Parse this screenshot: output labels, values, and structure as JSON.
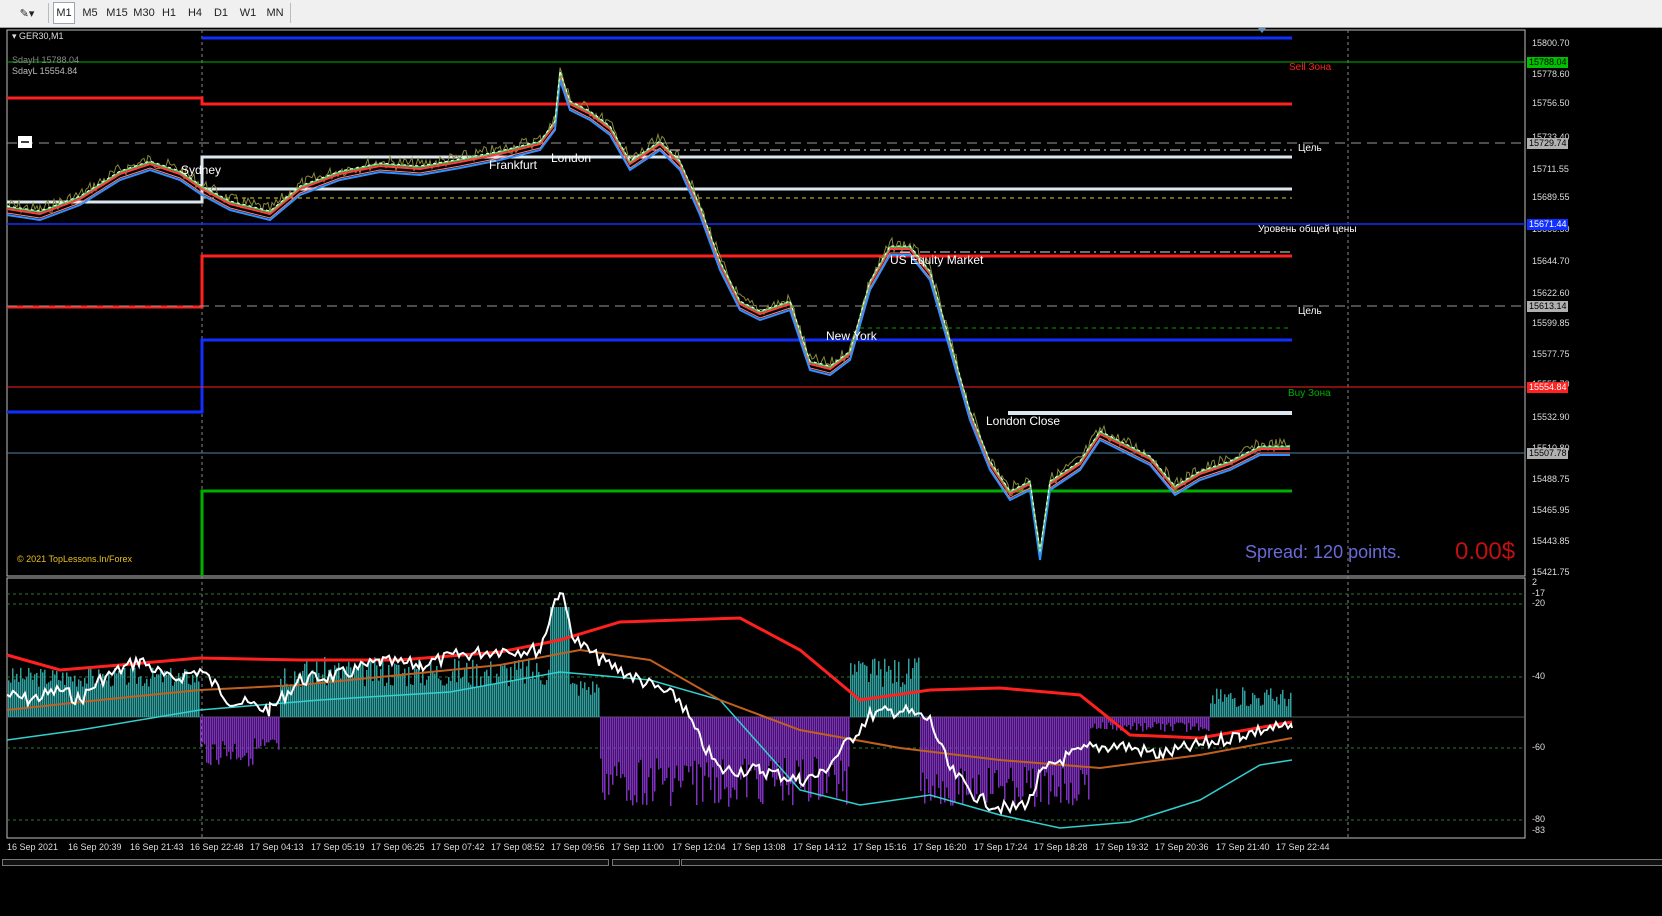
{
  "toolbar": {
    "timeframes": [
      "M1",
      "M5",
      "M15",
      "M30",
      "H1",
      "H4",
      "D1",
      "W1",
      "MN"
    ],
    "active": "M1"
  },
  "chart": {
    "symbol": "GER30,M1",
    "sdayh": "SdayH 15788.04",
    "sdayl": "SdayL 15554.84",
    "copyright": "© 2021 TopLessons.In/Forex",
    "spread": "Spread: 120 points.",
    "profit": "0.00$",
    "sessions": {
      "sydney": "Sydney",
      "frankfurt": "Frankfurt",
      "london": "London",
      "us_equity": "US Equity Market",
      "new_york": "New York",
      "london_close": "London Close"
    },
    "zones": {
      "sell": "Sell Зона",
      "buy": "Buy Зона",
      "target_top": "Цель",
      "target_mid": "Цель",
      "common_price": "Уровень общей цены"
    },
    "colors": {
      "sell": "#ff2020",
      "buy": "#00b000",
      "blue": "#1030ff",
      "white_level": "#dbe8f0",
      "session_line": "#d0d0d0"
    }
  },
  "price_axis": {
    "ticks": [
      "15800.70",
      "15778.60",
      "15756.50",
      "15733.40",
      "15711.55",
      "15689.55",
      "15666.50",
      "15644.70",
      "15622.60",
      "15599.85",
      "15577.75",
      "15555.70",
      "15532.90",
      "15510.80",
      "15488.75",
      "15465.95",
      "15443.85",
      "15421.75"
    ],
    "boxes": [
      {
        "value": "15788.04",
        "bg": "#00c000",
        "fg": "#000"
      },
      {
        "value": "15729.74",
        "bg": "#b0b0b0",
        "fg": "#000"
      },
      {
        "value": "15671.44",
        "bg": "#1030ff",
        "fg": "#fff"
      },
      {
        "value": "15613.14",
        "bg": "#b0b0b0",
        "fg": "#000"
      },
      {
        "value": "15554.84",
        "bg": "#ff2020",
        "fg": "#fff"
      },
      {
        "value": "15507.78",
        "bg": "#b0b0b0",
        "fg": "#000"
      }
    ]
  },
  "indicator_axis": {
    "ticks": [
      "2",
      "-17",
      "-20",
      "-40",
      "-60",
      "-80",
      "-83"
    ]
  },
  "time_axis": {
    "labels": [
      "16 Sep 2021",
      "16 Sep 20:39",
      "16 Sep 21:43",
      "16 Sep 22:48",
      "17 Sep 04:13",
      "17 Sep 05:19",
      "17 Sep 06:25",
      "17 Sep 07:42",
      "17 Sep 08:52",
      "17 Sep 09:56",
      "17 Sep 11:00",
      "17 Sep 12:04",
      "17 Sep 13:08",
      "17 Sep 14:12",
      "17 Sep 15:16",
      "17 Sep 16:20",
      "17 Sep 17:24",
      "17 Sep 18:28",
      "17 Sep 19:32",
      "17 Sep 20:36",
      "17 Sep 21:40",
      "17 Sep 22:44"
    ]
  }
}
